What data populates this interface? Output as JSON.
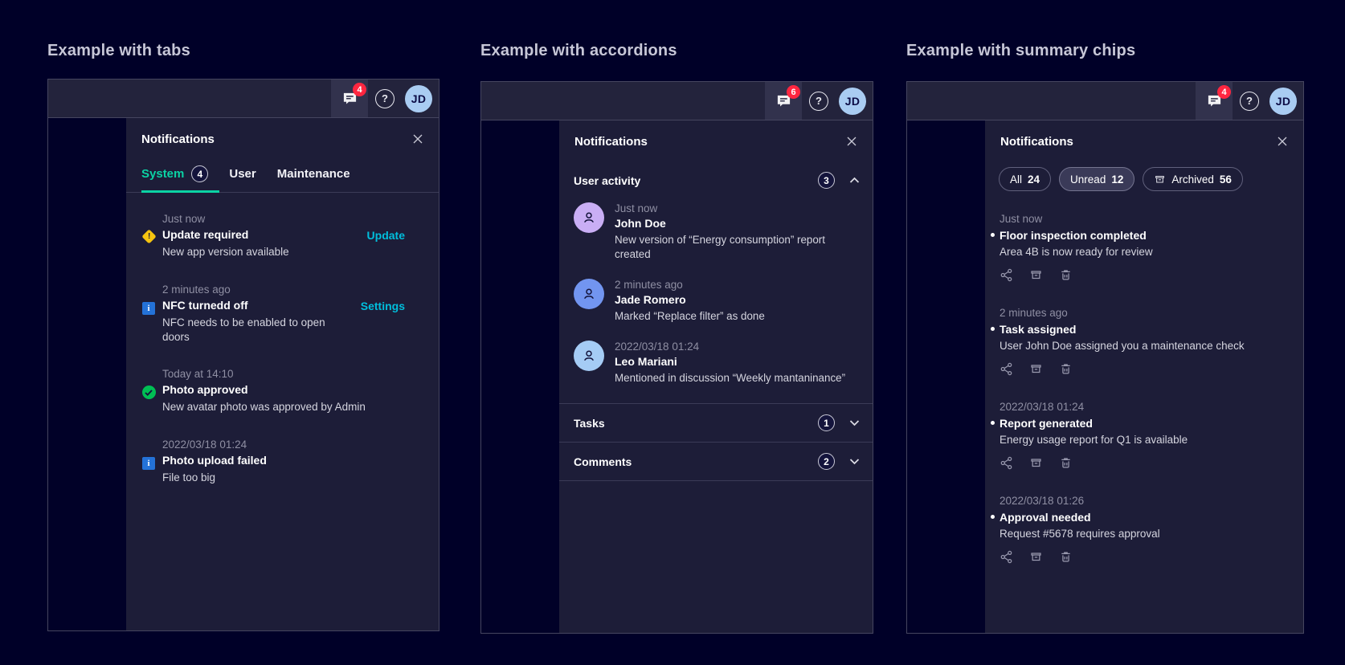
{
  "colors": {
    "accent_teal": "#0bd2a4",
    "link_cyan": "#00bedc",
    "alarm_red": "#ff2640",
    "warning_yellow": "#f5c410",
    "info_blue": "#2472d8",
    "success_green": "#00bf54",
    "avatar_blue": "#a9ccf2"
  },
  "examples": {
    "tabs": {
      "heading": "Example with tabs",
      "topbar": {
        "notification_count": "4",
        "help_glyph": "?",
        "avatar_initials": "JD"
      },
      "panel": {
        "title": "Notifications",
        "tabs": [
          {
            "label": "System",
            "count": "4",
            "active": true
          },
          {
            "label": "User"
          },
          {
            "label": "Maintenance"
          }
        ],
        "items": [
          {
            "icon": "warning-icon",
            "time": "Just now",
            "title": "Update required",
            "description": "New app version available",
            "action": "Update"
          },
          {
            "icon": "info-icon",
            "time": "2 minutes ago",
            "title": "NFC turnedd off",
            "description": "NFC needs to be enabled to open doors",
            "action": "Settings"
          },
          {
            "icon": "success-icon",
            "time": "Today at 14:10",
            "title": "Photo approved",
            "description": "New avatar photo was approved by Admin"
          },
          {
            "icon": "info-icon",
            "time": "2022/03/18 01:24",
            "title": "Photo upload failed",
            "description": "File too big"
          }
        ]
      }
    },
    "accordions": {
      "heading": "Example with accordions",
      "topbar": {
        "notification_count": "6",
        "help_glyph": "?",
        "avatar_initials": "JD"
      },
      "panel": {
        "title": "Notifications",
        "sections": [
          {
            "label": "User activity",
            "count": "3",
            "state": "expanded",
            "items": [
              {
                "avatar_color": "#c9aef5",
                "time": "Just now",
                "name": "John Doe",
                "description": "New version of “Energy consumption” report created"
              },
              {
                "avatar_color": "#7295f0",
                "time": "2 minutes ago",
                "name": "Jade Romero",
                "description": "Marked “Replace filter” as done"
              },
              {
                "avatar_color": "#a5ccf5",
                "time": "2022/03/18 01:24",
                "name": "Leo Mariani",
                "description": "Mentioned in discussion “Weekly mantaninance”"
              }
            ]
          },
          {
            "label": "Tasks",
            "count": "1",
            "state": "collapsed"
          },
          {
            "label": "Comments",
            "count": "2",
            "state": "collapsed"
          }
        ]
      }
    },
    "chips": {
      "heading": "Example with summary chips",
      "topbar": {
        "notification_count": "4",
        "help_glyph": "?",
        "avatar_initials": "JD"
      },
      "panel": {
        "title": "Notifications",
        "chips": [
          {
            "label": "All",
            "count": "24"
          },
          {
            "label": "Unread",
            "count": "12",
            "selected": true
          },
          {
            "label": "Archived",
            "count": "56",
            "icon": "archive-icon"
          }
        ],
        "item_actions": [
          "share-icon",
          "archive-icon",
          "trash-icon"
        ],
        "items": [
          {
            "time": "Just now",
            "title": "Floor inspection completed",
            "description": "Area 4B is now ready for review"
          },
          {
            "time": "2 minutes ago",
            "title": "Task assigned",
            "description": "User John Doe assigned you a maintenance check"
          },
          {
            "time": "2022/03/18 01:24",
            "title": "Report generated",
            "description": "Energy usage report for Q1 is available"
          },
          {
            "time": "2022/03/18 01:26",
            "title": "Approval needed",
            "description": "Request #5678 requires approval"
          }
        ]
      }
    }
  }
}
